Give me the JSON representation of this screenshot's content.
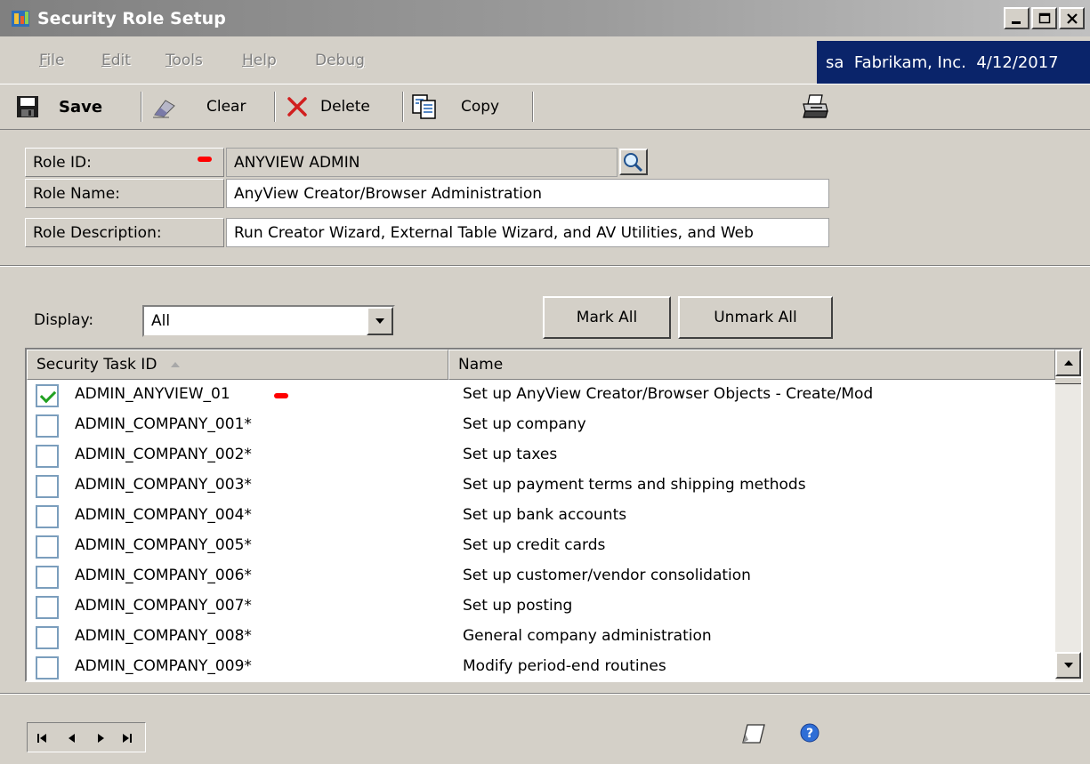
{
  "window": {
    "title": "Security Role Setup",
    "controls": {
      "minimize": "_",
      "maximize": "□",
      "close": "×"
    }
  },
  "menu": {
    "items": [
      {
        "label": "File",
        "underline": "F",
        "rest": "ile"
      },
      {
        "label": "Edit",
        "underline": "E",
        "rest": "dit"
      },
      {
        "label": "Tools",
        "underline": "T",
        "rest": "ools"
      },
      {
        "label": "Help",
        "underline": "H",
        "rest": "elp"
      },
      {
        "label": "Debug",
        "pre": "Debu",
        "underline": "g"
      }
    ]
  },
  "company": {
    "user": "sa",
    "name": "Fabrikam, Inc.",
    "date": "4/12/2017",
    "background": "#0a246a"
  },
  "toolbar": {
    "save": "Save",
    "clear": "Clear",
    "delete": "Delete",
    "copy": "Copy",
    "icons": [
      "floppy-disk-icon",
      "eraser-icon",
      "delete-x-icon",
      "copy-icon",
      "printer-icon"
    ]
  },
  "form": {
    "role_id_label": "Role ID:",
    "role_id_value": "ANYVIEW ADMIN",
    "role_name_label": "Role Name:",
    "role_name_value": "AnyView Creator/Browser Administration",
    "role_description_label": "Role Description:",
    "role_description_value": "Run Creator Wizard, External Table Wizard, and AV Utilities, and Web",
    "required_color": "#ff0000"
  },
  "display": {
    "label": "Display:",
    "value": "All"
  },
  "buttons": {
    "mark_all": "Mark All",
    "unmark_all": "Unmark All"
  },
  "grid": {
    "columns": [
      "Security Task ID",
      "Name"
    ],
    "sorted_column": "Security Task ID",
    "rows": [
      {
        "checked": true,
        "id": "ADMIN_ANYVIEW_01",
        "name": "Set up AnyView Creator/Browser Objects - Create/Mod"
      },
      {
        "checked": false,
        "id": "ADMIN_COMPANY_001*",
        "name": "Set up company"
      },
      {
        "checked": false,
        "id": "ADMIN_COMPANY_002*",
        "name": "Set up taxes"
      },
      {
        "checked": false,
        "id": "ADMIN_COMPANY_003*",
        "name": "Set up payment terms and shipping methods"
      },
      {
        "checked": false,
        "id": "ADMIN_COMPANY_004*",
        "name": "Set up bank accounts"
      },
      {
        "checked": false,
        "id": "ADMIN_COMPANY_005*",
        "name": "Set up credit cards"
      },
      {
        "checked": false,
        "id": "ADMIN_COMPANY_006*",
        "name": "Set up customer/vendor consolidation"
      },
      {
        "checked": false,
        "id": "ADMIN_COMPANY_007*",
        "name": "Set up posting"
      },
      {
        "checked": false,
        "id": "ADMIN_COMPANY_008*",
        "name": "General company administration"
      },
      {
        "checked": false,
        "id": "ADMIN_COMPANY_009*",
        "name": "Modify period-end routines"
      }
    ]
  },
  "footer": {
    "nav_icons": [
      "first-record-icon",
      "previous-record-icon",
      "next-record-icon",
      "last-record-icon"
    ],
    "icons": [
      "note-icon",
      "help-icon"
    ]
  }
}
